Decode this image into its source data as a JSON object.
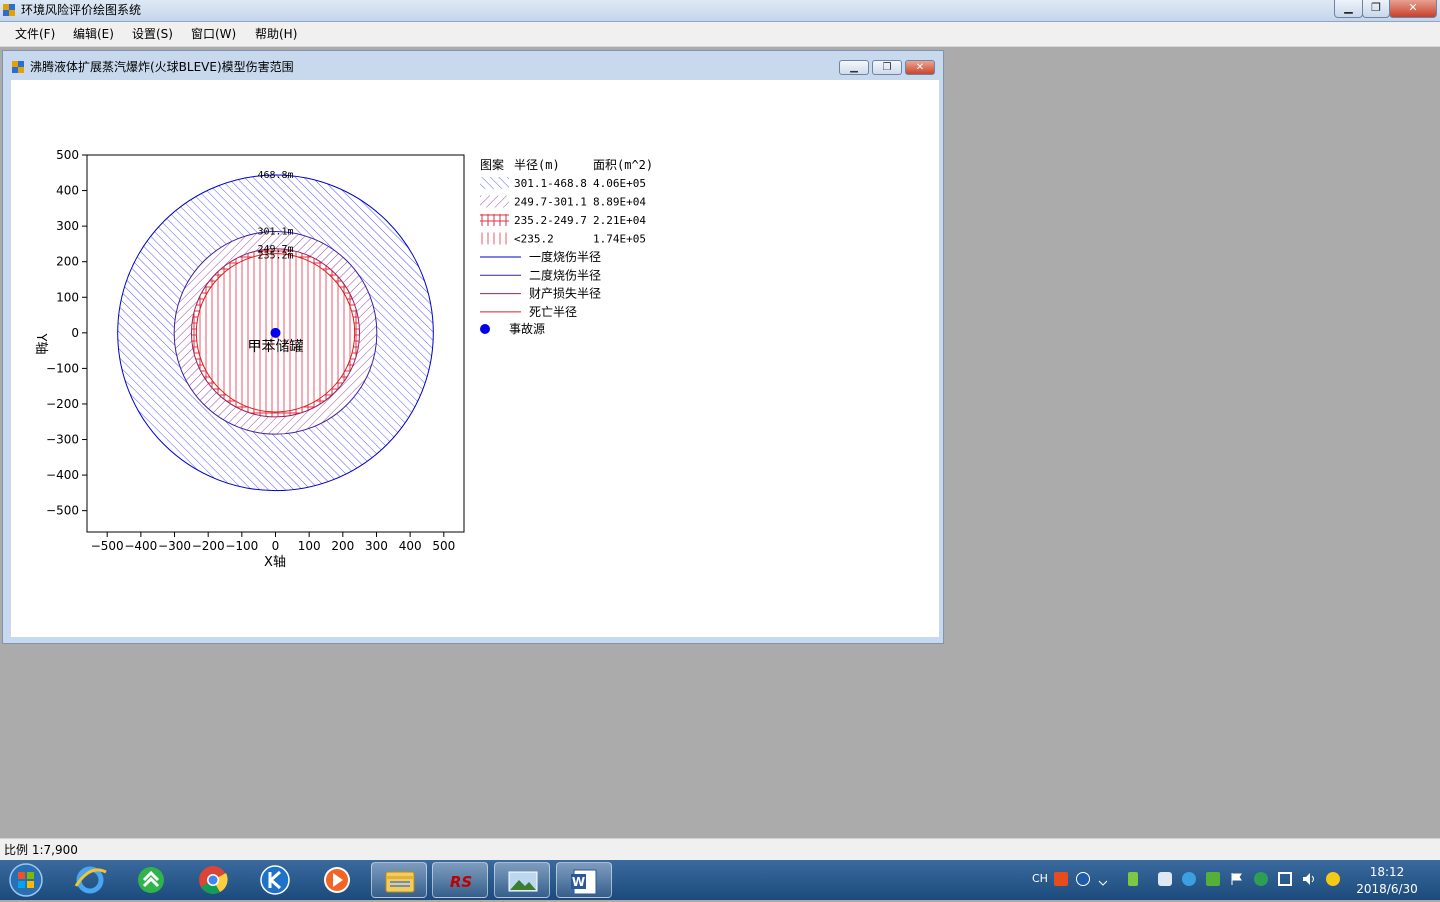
{
  "app": {
    "title": "环境风险评价绘图系统",
    "minimize": "▁",
    "maximize": "❐",
    "close": "✕"
  },
  "menu": [
    {
      "label": "文件(F)"
    },
    {
      "label": "编辑(E)"
    },
    {
      "label": "设置(S)"
    },
    {
      "label": "窗口(W)"
    },
    {
      "label": "帮助(H)"
    }
  ],
  "child": {
    "title": "沸腾液体扩展蒸汽爆炸(火球BLEVE)模型伤害范围",
    "minimize": "▁",
    "maximize": "❐",
    "close": "✕"
  },
  "chart_data": {
    "type": "contour-circles",
    "xlabel": "X轴",
    "ylabel": "Y轴",
    "xlim": [
      -560,
      560
    ],
    "ylim": [
      -560,
      500
    ],
    "xticks": [
      -500,
      -400,
      -300,
      -200,
      -100,
      0,
      100,
      200,
      300,
      400,
      500
    ],
    "yticks": [
      500,
      400,
      300,
      200,
      100,
      0,
      -100,
      -200,
      -300,
      -400,
      -500
    ],
    "source": {
      "x": 0,
      "y": 0,
      "label": "甲苯储罐"
    },
    "circles": [
      {
        "radius": 468.8,
        "label": "468.8m",
        "color": "#0000cc"
      },
      {
        "radius": 301.1,
        "label": "301.1m",
        "color": "#3b1fa0"
      },
      {
        "radius": 249.7,
        "label": "249.7m",
        "color": "#a0205a"
      },
      {
        "radius": 235.2,
        "label": "235.2m",
        "color": "#dd1f1f"
      }
    ],
    "legend": {
      "headers": [
        "图案",
        "半径(m)",
        "面积(m^2)"
      ],
      "rows": [
        {
          "range": "301.1-468.8",
          "area": "4.06E+05",
          "pattern": "diag-blue"
        },
        {
          "range": "249.7-301.1",
          "area": "8.89E+04",
          "pattern": "diag-purple"
        },
        {
          "range": "235.2-249.7",
          "area": "2.21E+04",
          "pattern": "cross-red"
        },
        {
          "range": "<235.2",
          "area": "1.74E+05",
          "pattern": "vert-red"
        }
      ],
      "lines": [
        {
          "label": "一度烧伤半径",
          "color": "#0000cc"
        },
        {
          "label": "二度烧伤半径",
          "color": "#3b1fa0"
        },
        {
          "label": "财产损失半径",
          "color": "#a0205a"
        },
        {
          "label": "死亡半径",
          "color": "#dd1f1f"
        }
      ],
      "source_label": "事故源"
    }
  },
  "status": {
    "scale": "比例 1:7,900"
  },
  "taskbar": {
    "apps": [
      "start",
      "ie-icon",
      "update-icon",
      "chrome-icon",
      "k-icon",
      "media-icon",
      "explorer-icon",
      "rs-icon",
      "photo-icon",
      "word-icon"
    ],
    "rs_label": "RS",
    "word_label": "W",
    "lang": "CH",
    "clock_time": "18:12",
    "clock_date": "2018/6/30"
  }
}
